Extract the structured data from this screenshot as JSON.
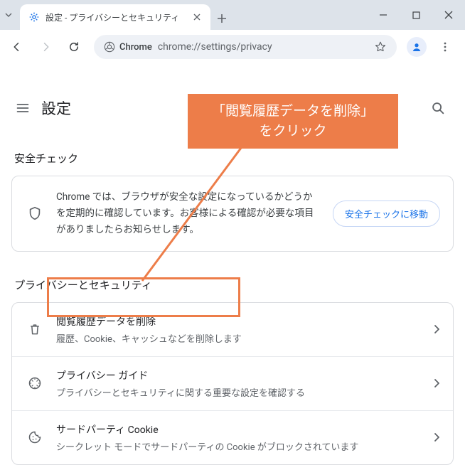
{
  "window": {
    "tab_title": "設定 - プライバシーとセキュリティ",
    "new_tab_tooltip": "+"
  },
  "toolbar": {
    "site_label": "Chrome",
    "url": "chrome://settings/privacy"
  },
  "app": {
    "title": "設定"
  },
  "safety_section": {
    "title": "安全チェック",
    "body": "Chrome では、ブラウザが安全な設定になっているかどうかを定期的に確認しています。お客様による確認が必要な項目がありましたらお知らせします。",
    "button": "安全チェックに移動"
  },
  "privacy_section": {
    "title": "プライバシーとセキュリティ",
    "rows": [
      {
        "primary": "閲覧履歴データを削除",
        "secondary": "履歴、Cookie、キャッシュなどを削除します"
      },
      {
        "primary": "プライバシー ガイド",
        "secondary": "プライバシーとセキュリティに関する重要な設定を確認する"
      },
      {
        "primary": "サードパーティ Cookie",
        "secondary": "シークレット モードでサードパーティの Cookie がブロックされています"
      }
    ]
  },
  "annotation": {
    "line1": "「閲覧履歴データを削除」",
    "line2": "をクリック"
  }
}
